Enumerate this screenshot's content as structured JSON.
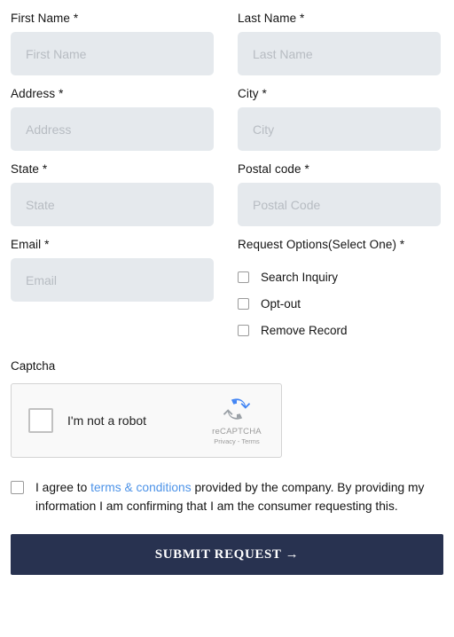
{
  "form": {
    "rows": [
      {
        "left": {
          "label": "First Name *",
          "placeholder": "First Name",
          "value": ""
        },
        "right": {
          "label": "Last Name *",
          "placeholder": "Last Name",
          "value": ""
        }
      },
      {
        "left": {
          "label": "Address *",
          "placeholder": "Address",
          "value": ""
        },
        "right": {
          "label": "City *",
          "placeholder": "City",
          "value": ""
        }
      },
      {
        "left": {
          "label": "State *",
          "placeholder": "State",
          "value": ""
        },
        "right": {
          "label": "Postal code *",
          "placeholder": "Postal Code",
          "value": ""
        }
      }
    ],
    "email": {
      "label": "Email *",
      "placeholder": "Email",
      "value": ""
    },
    "request_options": {
      "label": "Request Options(Select One) *",
      "items": [
        {
          "label": "Search Inquiry",
          "checked": false
        },
        {
          "label": "Opt-out",
          "checked": false
        },
        {
          "label": "Remove Record",
          "checked": false
        }
      ]
    },
    "captcha": {
      "label": "Captcha",
      "checkbox_label": "I'm not a robot",
      "checked": false,
      "brand_name": "reCAPTCHA",
      "brand_links": "Privacy - Terms"
    },
    "consent": {
      "checked": false,
      "text_before": "I agree to ",
      "link_text": "terms & conditions",
      "text_after": " provided by the company. By providing my information I am confirming that I am the consumer requesting this."
    },
    "submit": {
      "label": "SUBMIT REQUEST →"
    }
  },
  "colors": {
    "input_background": "#e5e9ed",
    "placeholder": "#b7bcc2",
    "label_text": "#141414",
    "link_blue": "#4d93e8",
    "submit_navy": "#283250",
    "captcha_background": "#f9f9f9",
    "recaptcha_blue": "#4285f4",
    "recaptcha_grey": "#9aa0a6"
  }
}
